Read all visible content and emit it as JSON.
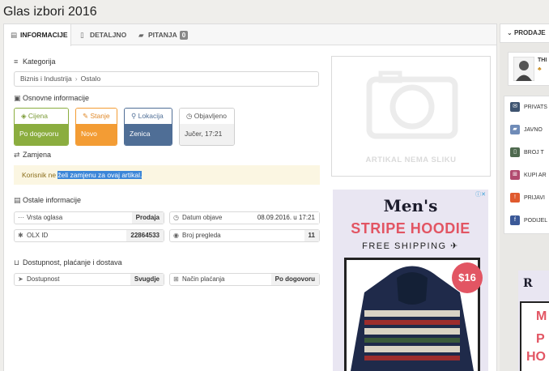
{
  "page_title": "Glas izbori 2016",
  "tabs": [
    {
      "label": "INFORMACIJE",
      "icon": "info-icon"
    },
    {
      "label": "DETALJNO",
      "icon": "document-icon"
    },
    {
      "label": "PITANJA",
      "icon": "chat-icon",
      "badge": "0"
    }
  ],
  "category": {
    "heading": "Kategorija",
    "path": [
      "Biznis i Industrija",
      "Ostalo"
    ]
  },
  "basic_info": {
    "heading": "Osnovne informacije",
    "boxes": [
      {
        "label": "Cijena",
        "value": "Po dogovoru",
        "color": "#8bad3f"
      },
      {
        "label": "Stanje",
        "value": "Novo",
        "color": "#f39c34"
      },
      {
        "label": "Lokacija",
        "value": "Zenica",
        "color": "#4f6e96"
      },
      {
        "label": "Objavljeno",
        "value": "Jučer, 17:21",
        "color": "#cfcfcf"
      }
    ]
  },
  "exchange": {
    "heading": "Zamjena",
    "text_plain": "Korisnik ne ",
    "text_highlight": "želi zamjenu za ovaj artikal."
  },
  "other_info": {
    "heading": "Ostale informacije",
    "rows": [
      {
        "label": "Vrsta oglasa",
        "value": "Prodaja"
      },
      {
        "label": "Datum objave",
        "value": "08.09.2016. u 17:21"
      },
      {
        "label": "OLX ID",
        "value": "22864533"
      },
      {
        "label": "Broj pregleda",
        "value": "11"
      }
    ]
  },
  "availability": {
    "heading": "Dostupnost, plaćanje i dostava",
    "rows": [
      {
        "label": "Dostupnost",
        "value": "Svugdje"
      },
      {
        "label": "Način plaćanja",
        "value": "Po dogovoru"
      }
    ]
  },
  "no_image_text": "ARTIKAL NEMA SLIKU",
  "ad": {
    "title": "Men's",
    "headline": "STRIPE HOODIE",
    "sub": "FREE SHIPPING",
    "price": "$16"
  },
  "right_panel": {
    "heading": "PRODAJE",
    "user_name": "THI",
    "links": [
      {
        "label": "PRIVATS",
        "color": "#3e5470"
      },
      {
        "label": "JAVNO",
        "color": "#6f8bb7"
      },
      {
        "label": "BROJ T",
        "color": "#4f6a4f"
      },
      {
        "label": "KUPI AR",
        "color": "#b14a6f"
      },
      {
        "label": "PRIJAVI",
        "color": "#e05a2e"
      },
      {
        "label": "PODIJEL",
        "color": "#3b5998"
      }
    ],
    "ad_fragments": [
      "R",
      "M",
      "P",
      "HO"
    ]
  }
}
